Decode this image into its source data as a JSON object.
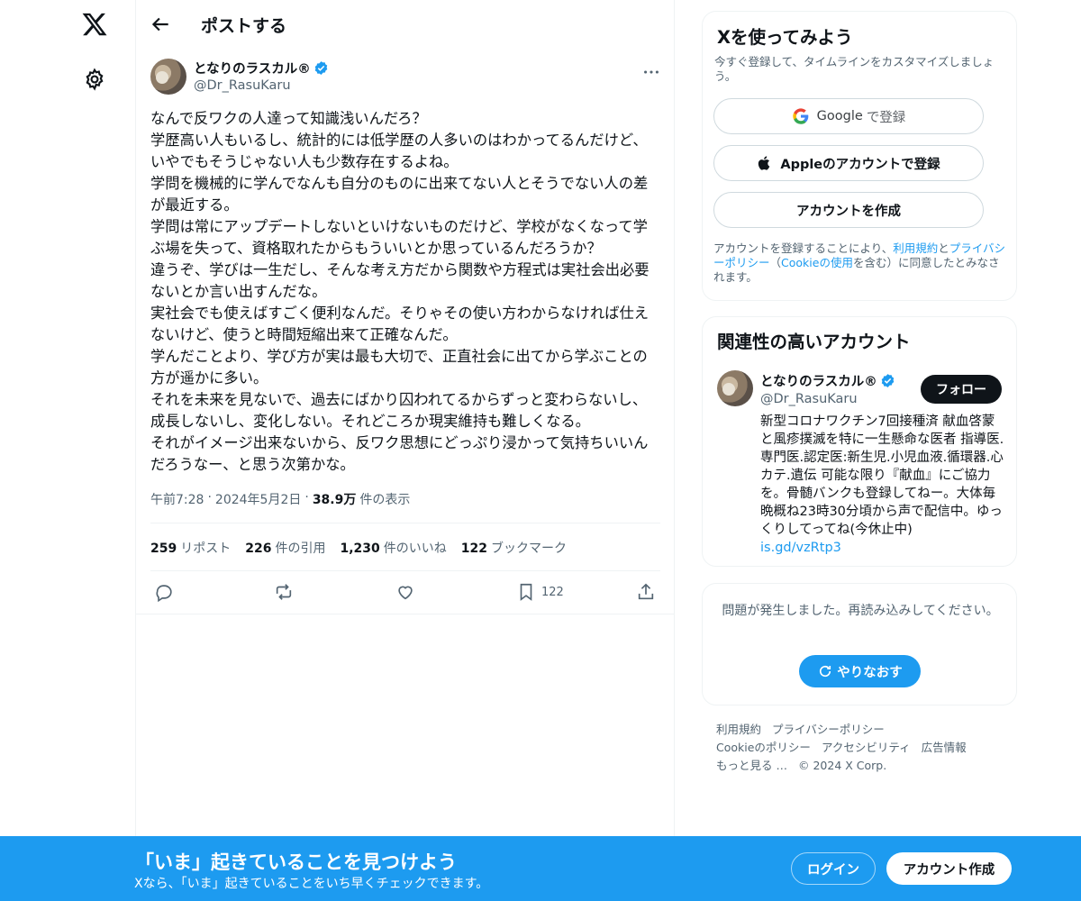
{
  "header": {
    "title": "ポストする"
  },
  "icons": {
    "logo": "x-logo-icon",
    "settings": "gear-icon",
    "back": "arrow-left-icon",
    "more": "more-horizontal-icon"
  },
  "author": {
    "name": "となりのラスカル®",
    "handle": "@Dr_RasuKaru"
  },
  "tweet": {
    "text": "なんで反ワクの人達って知識浅いんだろ？\n学歴高い人もいるし、統計的には低学歴の人多いのはわかってるんだけど、いやでもそうじゃない人も少数存在するよね。\n学問を機械的に学んでなんも自分のものに出来てない人とそうでない人の差が最近する。\n学問は常にアップデートしないといけないものだけど、学校がなくなって学ぶ場を失って、資格取れたからもういいとか思っているんだろうか？\n違うぞ、学びは一生だし、そんな考え方だから関数や方程式は実社会出必要ないとか言い出すんだな。\n実社会でも使えばすごく便利なんだ。そりゃその使い方わからなければ仕えないけど、使うと時間短縮出来て正確なんだ。\n学んだことより、学び方が実は最も大切で、正直社会に出てから学ぶことの方が遥かに多い。\nそれを未来を見ないで、過去にばかり囚われてるからずっと変わらないし、成長しないし、変化しない。それどころか現実維持も難しくなる。\nそれがイメージ出来ないから、反ワク思想にどっぷり浸かって気持ちいいんだろうなー、と思う次第かな。",
    "time": "午前7:28",
    "date": "2024年5月2日",
    "views": "38.9万",
    "views_label": "件の表示",
    "stats": {
      "reposts": "259",
      "reposts_label": "リポスト",
      "quotes": "226",
      "quotes_label": "件の引用",
      "likes": "1,230",
      "likes_label": "件のいいね",
      "bookmarks": "122",
      "bookmarks_label": "ブックマーク"
    },
    "bookmark_count": "122"
  },
  "signup": {
    "title": "Xを使ってみよう",
    "subtitle": "今すぐ登録して、タイムラインをカスタマイズしましょう。",
    "google_brand": "Google",
    "google_suffix": "で登録",
    "apple_label": "Appleのアカウントで登録",
    "create_label": "アカウントを作成",
    "legal_pre": "アカウントを登録することにより、",
    "legal_terms": "利用規約",
    "legal_and": "と",
    "legal_privacy": "プライバシーポリシー",
    "legal_mid": "（",
    "legal_cookie": "Cookieの使用",
    "legal_post": "を含む）に同意したとみなされます。"
  },
  "relevant": {
    "title": "関連性の高いアカウント",
    "name": "となりのラスカル®",
    "handle": "@Dr_RasuKaru",
    "follow_label": "フォロー",
    "bio": "新型コロナワクチン7回接種済 献血啓蒙と風疹撲滅を特に一生懸命な医者 指導医.専門医.認定医:新生児.小児血液.循環器.心カテ.遺伝 可能な限り『献血』にご協力を。骨髄バンクも登録してねー。大体毎晩概ね23時30分頃から声で配信中。ゆっくりしてってね(今休止中)\n",
    "bio_link": "is.gd/vzRtp3"
  },
  "error": {
    "message": "問題が発生しました。再読み込みしてください。",
    "retry_label": "やりなおす"
  },
  "footer": {
    "links": [
      "利用規約",
      "プライバシーポリシー",
      "Cookieのポリシー",
      "アクセシビリティ",
      "広告情報",
      "もっと見る …"
    ],
    "copyright": "© 2024 X Corp."
  },
  "banner": {
    "title": "「いま」起きていることを見つけよう",
    "subtitle": "Xなら、「いま」起きていることをいち早くチェックできます。",
    "login_label": "ログイン",
    "create_label": "アカウント作成"
  },
  "colors": {
    "accent": "#1d9bf0",
    "text": "#0f1419",
    "muted": "#536471",
    "border": "#eff3f4"
  }
}
